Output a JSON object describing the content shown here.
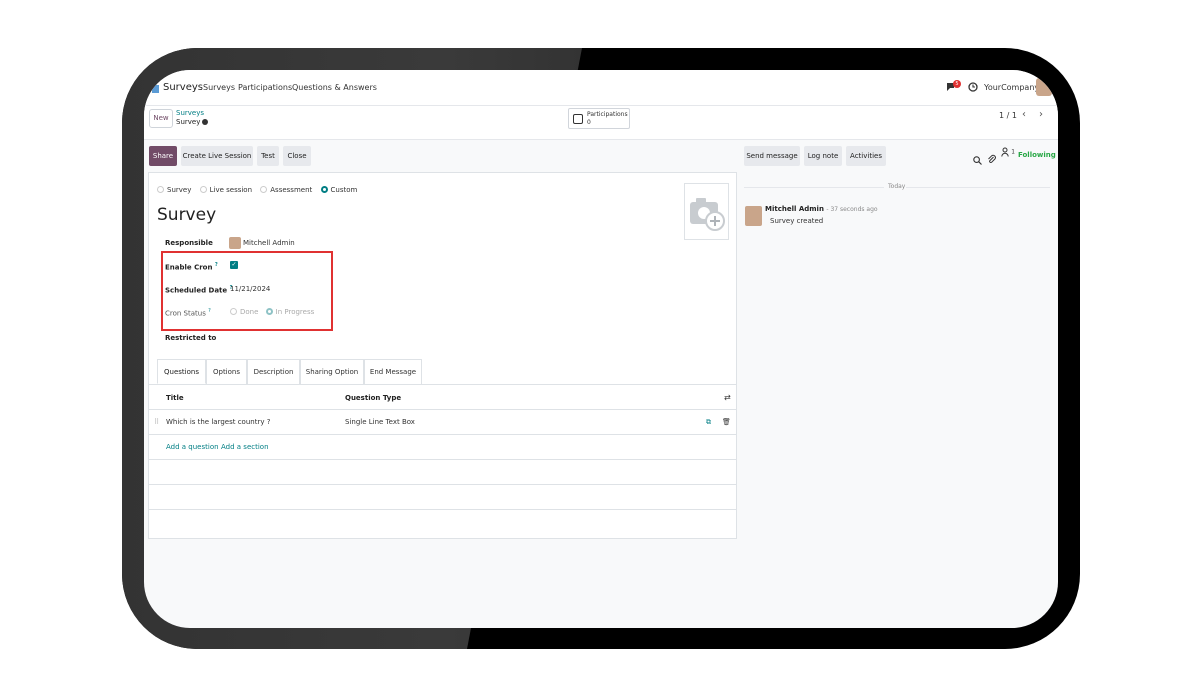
{
  "navbar": {
    "app_name": "Surveys",
    "menu": [
      "Surveys",
      "Participations",
      "Questions & Answers"
    ],
    "notification_count": "5",
    "company": "YourCompany"
  },
  "control_panel": {
    "new_label": "New",
    "breadcrumb_parent": "Surveys",
    "breadcrumb_current": "Survey",
    "smart_button": {
      "label": "Participations",
      "count": "0"
    },
    "pager": "1 / 1"
  },
  "toolbar": {
    "share": "Share",
    "create_live_session": "Create Live Session",
    "test": "Test",
    "close": "Close"
  },
  "form": {
    "survey_types": [
      "Survey",
      "Live session",
      "Assessment",
      "Custom"
    ],
    "selected_type": "Custom",
    "title": "Survey",
    "responsible_label": "Responsible",
    "responsible_value": "Mitchell Admin",
    "enable_cron_label": "Enable Cron",
    "enable_cron_checked": true,
    "scheduled_date_label": "Scheduled Date",
    "scheduled_date_value": "11/21/2024",
    "cron_status_label": "Cron Status",
    "cron_status_options": [
      "Done",
      "In Progress"
    ],
    "cron_status_selected": "In Progress",
    "restricted_label": "Restricted to",
    "help_mark": "?"
  },
  "tabs": [
    "Questions",
    "Options",
    "Description",
    "Sharing Option",
    "End Message"
  ],
  "questions_table": {
    "headers": [
      "Title",
      "Question Type"
    ],
    "rows": [
      {
        "title": "Which is the largest country ?",
        "type": "Single Line Text Box"
      }
    ],
    "add_question": "Add a question",
    "add_section": "Add a section"
  },
  "chatter": {
    "send_message": "Send message",
    "log_note": "Log note",
    "activities": "Activities",
    "follower_count": "1",
    "following": "Following",
    "date_separator": "Today",
    "message": {
      "author": "Mitchell Admin",
      "time": "- 37 seconds ago",
      "body": "Survey created"
    }
  },
  "colors": {
    "primary": "#714b67",
    "accent": "#017e84",
    "highlight": "#e03131",
    "following": "#28a745"
  }
}
